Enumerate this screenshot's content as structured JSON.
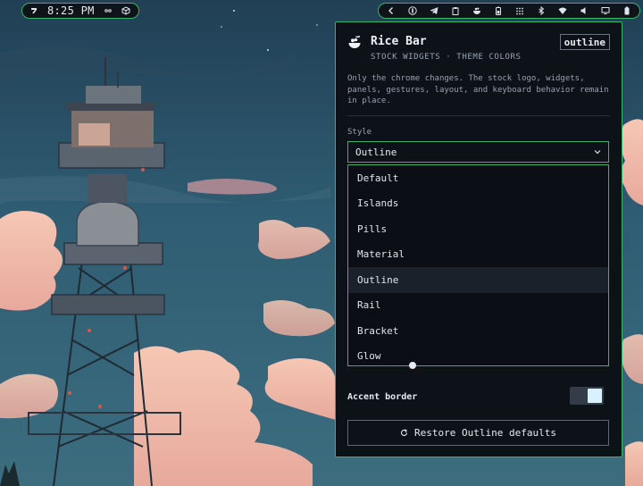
{
  "topbar": {
    "clock": "8:25 PM",
    "left_icons": [
      "distro-logo-icon",
      "circle-dots-icon",
      "box-icon"
    ],
    "right_icons": [
      "chevron-left-icon",
      "password-manager-icon",
      "telegram-icon",
      "clipboard-icon",
      "rice-icon",
      "battery-saver-icon",
      "apps-grid-icon",
      "bluetooth-icon",
      "wifi-icon",
      "volume-icon",
      "display-icon",
      "battery-icon"
    ]
  },
  "panel": {
    "title": "Rice Bar",
    "subtitle": "STOCK WIDGETS · THEME COLORS",
    "style_badge": "outline",
    "description": "Only the chrome changes. The stock logo, widgets, panels, gestures, layout, and keyboard behavior remain in place.",
    "style_label": "Style",
    "selected_style": "Outline",
    "options": [
      "Default",
      "Islands",
      "Pills",
      "Material",
      "Outline",
      "Rail",
      "Bracket",
      "Glow"
    ],
    "accent_border_label": "Accent border",
    "accent_border_on": true,
    "restore_label": "Restore Outline defaults"
  },
  "colors": {
    "accent": "#39b36a",
    "panel_bg": "#0d1118",
    "selected_row": "#1b212b"
  }
}
